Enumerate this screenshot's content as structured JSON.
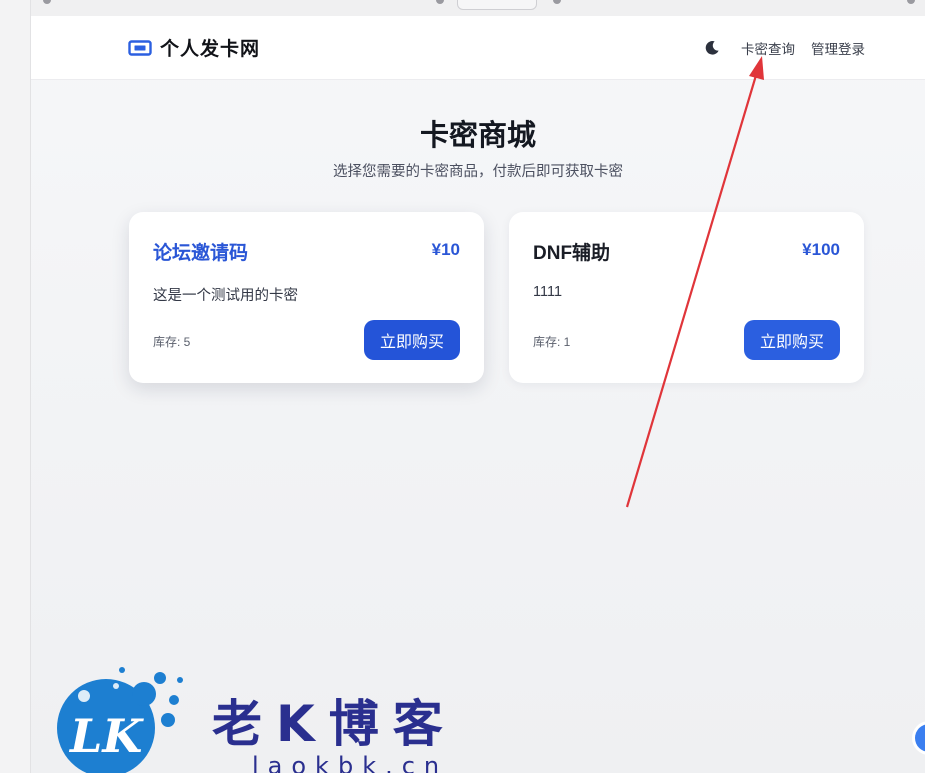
{
  "site": {
    "brand_name": "个人发卡网",
    "brand_icon": "ticket-icon",
    "theme_icon": "moon-icon",
    "nav_links": [
      "卡密查询",
      "管理登录"
    ]
  },
  "hero": {
    "title": "卡密商城",
    "subtitle": "选择您需要的卡密商品，付款后即可获取卡密"
  },
  "products": [
    {
      "name": "论坛邀请码",
      "price": "¥10",
      "description": "这是一个测试用的卡密",
      "stock": "库存: 5",
      "buy_label": "立即购买",
      "title_color": "#2a56d6"
    },
    {
      "name": "DNF辅助",
      "price": "¥100",
      "description": "1111",
      "stock": "库存: 1",
      "buy_label": "立即购买",
      "title_color": "#1a1d26"
    }
  ],
  "annotation": {
    "arrow_color": "#e0353a"
  },
  "watermark": {
    "logo_text": "LK",
    "name": "老K博客",
    "url": "laokbk.cn"
  },
  "colors": {
    "accent": "#2b5fe0",
    "price": "#2a56d6"
  }
}
